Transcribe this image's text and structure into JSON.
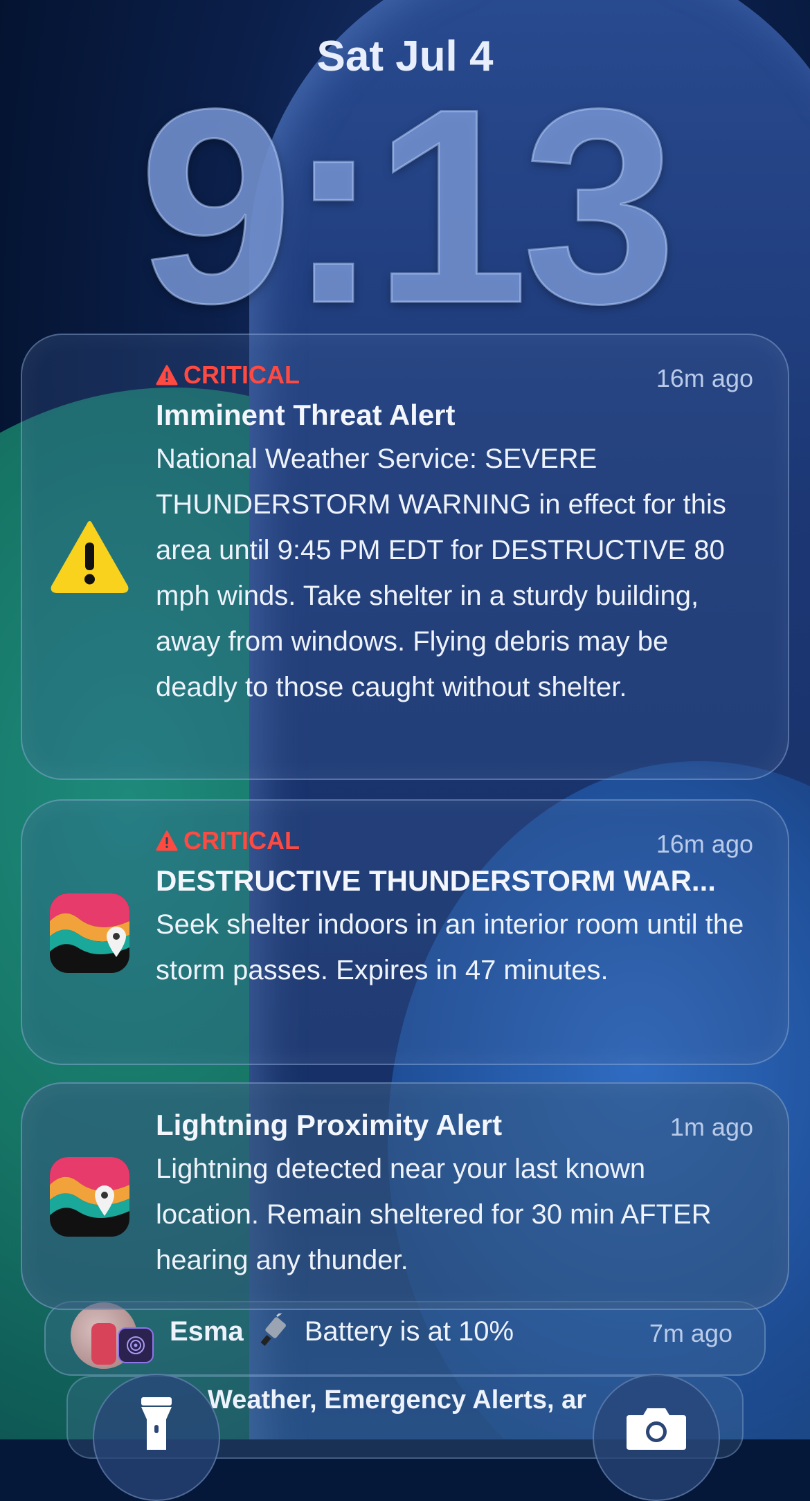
{
  "lockscreen": {
    "date": "Sat Jul 4",
    "time": "9:13"
  },
  "notifications": [
    {
      "tag": "CRITICAL",
      "title": "Imminent Threat Alert",
      "body": "National Weather Service: SEVERE THUNDERSTORM WARNING in effect for this area until 9:45 PM EDT for DESTRUCTIVE 80 mph winds. Take shelter in a sturdy building, away from windows. Flying debris may be deadly to those caught without shelter.",
      "time": "16m ago",
      "icon": "warning-triangle-icon"
    },
    {
      "tag": "CRITICAL",
      "title": "DESTRUCTIVE THUNDERSTORM WAR...",
      "body": "Seek shelter indoors in an interior room until the storm passes. Expires in 47 minutes.",
      "time": "16m ago",
      "icon": "weather-radar-app-icon"
    },
    {
      "title": "Lightning Proximity Alert",
      "body": "Lightning detected near your last known location. Remain sheltered for 30 min AFTER hearing any thunder.",
      "time": "1m ago",
      "icon": "weather-radar-app-icon"
    }
  ],
  "stacked": {
    "esma_name": "Esma",
    "esma_text": "Battery is at 10%",
    "esma_time": "7m ago",
    "group_label": "Weather, Emergency Alerts, ar"
  },
  "colors": {
    "critical": "#ff4a42",
    "warning_yellow": "#f8d21c"
  }
}
